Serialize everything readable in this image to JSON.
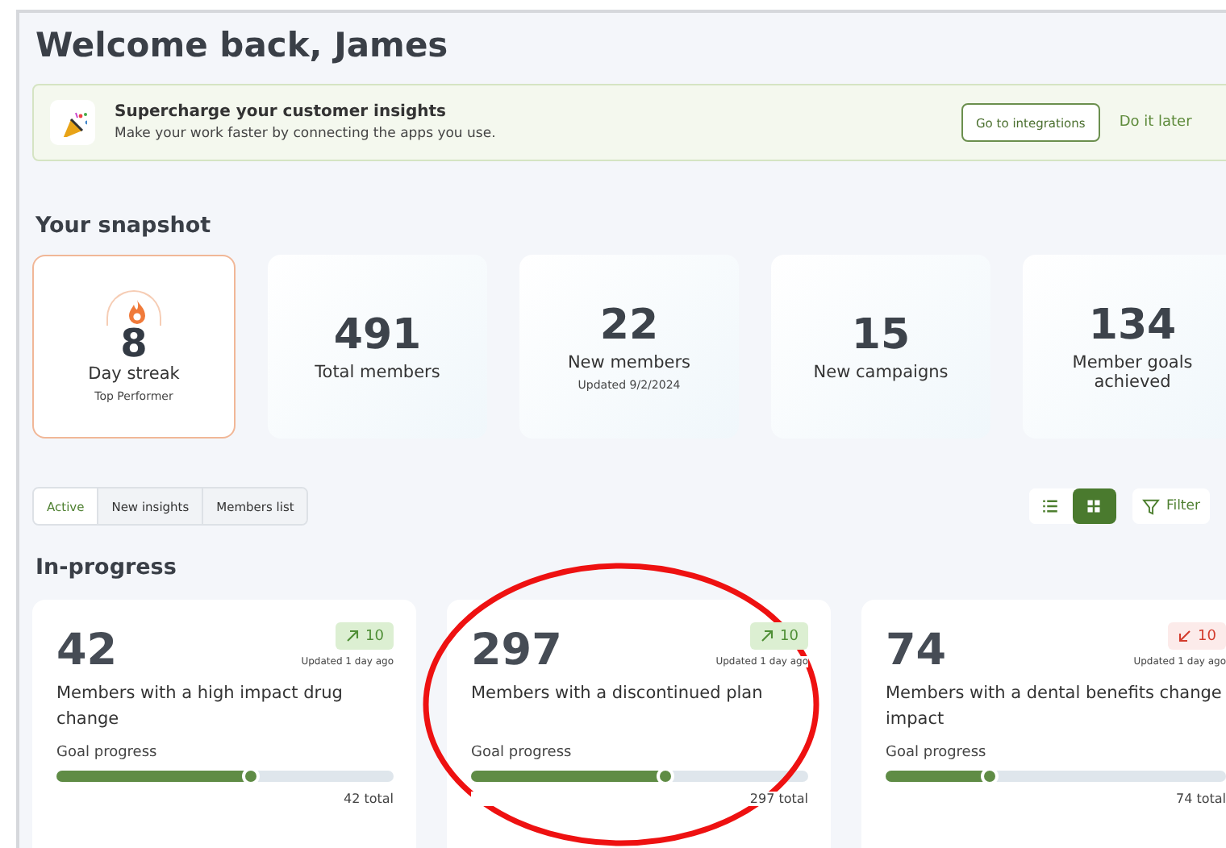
{
  "header": {
    "title": "Welcome back, James"
  },
  "banner": {
    "title": "Supercharge your customer insights",
    "text": "Make your work faster by connecting the apps you use.",
    "primary_button": "Go to integrations",
    "secondary_link": "Do it later"
  },
  "snapshot": {
    "title": "Your snapshot",
    "cards": [
      {
        "kind": "streak",
        "value": "8",
        "label": "Day streak",
        "sub": "Top Performer"
      },
      {
        "kind": "stat",
        "value": "491",
        "label": "Total members"
      },
      {
        "kind": "stat",
        "value": "22",
        "label": "New members",
        "sub": "Updated 9/2/2024"
      },
      {
        "kind": "stat",
        "value": "15",
        "label": "New campaigns"
      },
      {
        "kind": "stat",
        "value": "134",
        "label": "Member goals achieved"
      }
    ]
  },
  "tabs": [
    {
      "label": "Active",
      "selected": true
    },
    {
      "label": "New insights",
      "selected": false
    },
    {
      "label": "Members list",
      "selected": false
    }
  ],
  "view_toggle": [
    {
      "kind": "list",
      "selected": false
    },
    {
      "kind": "grid",
      "selected": true
    }
  ],
  "filters_button": "Filter",
  "in_progress": {
    "title": "In-progress",
    "cards": [
      {
        "value": "42",
        "kind": "increase",
        "change": "10",
        "updated": "Updated 1 day ago",
        "title": "Members with a high impact drug change",
        "progress_label": "Goal progress",
        "level": 0.58,
        "total": "42 total"
      },
      {
        "value": "297",
        "kind": "increase",
        "change": "10",
        "updated": "Updated 1 day ago",
        "title": "Members with a discontinued plan",
        "progress_label": "Goal progress",
        "level": 0.58,
        "total": "297 total"
      },
      {
        "value": "74",
        "kind": "decrease",
        "change": "10",
        "updated": "Updated 1 day ago",
        "title": "Members with a dental benefits change impact",
        "progress_label": "Goal progress",
        "level": 0.31,
        "total": "74 total"
      }
    ]
  },
  "annotations": [
    {
      "kind": "ellipse"
    }
  ]
}
